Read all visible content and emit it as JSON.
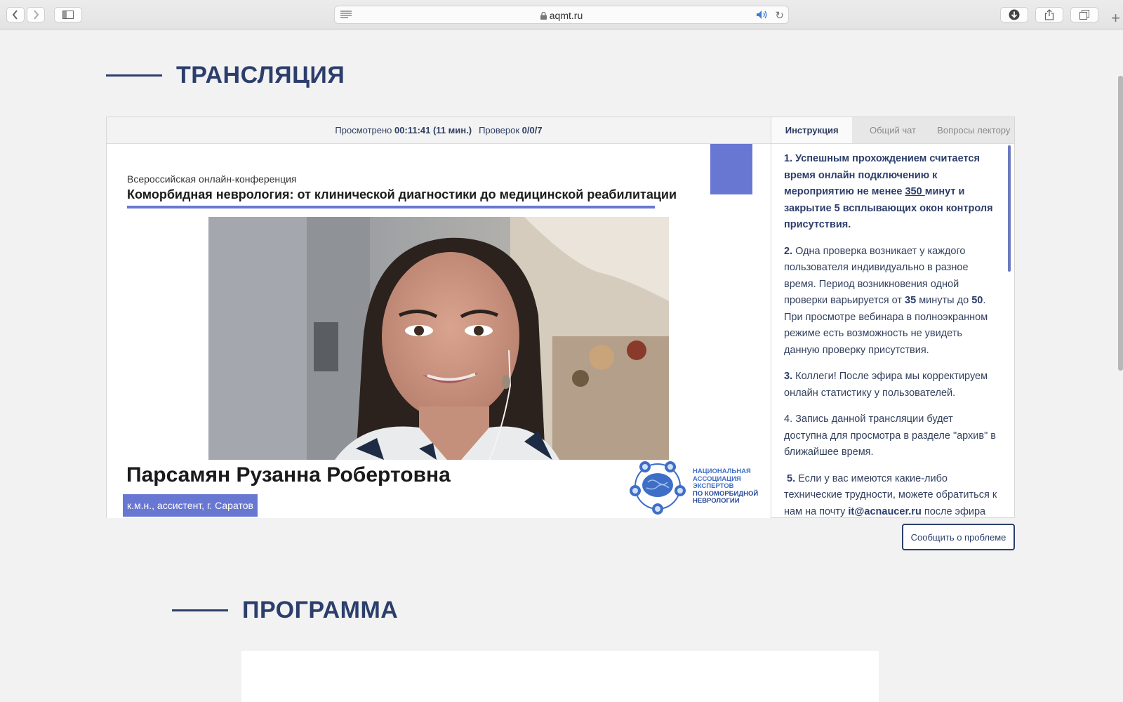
{
  "browser": {
    "url": "aqmt.ru",
    "icons": [
      "back-icon",
      "forward-icon",
      "sidebar-icon",
      "reader-icon",
      "lock-icon",
      "sound-icon",
      "reload-icon",
      "download-icon",
      "share-icon",
      "tabs-icon",
      "new-tab-icon"
    ]
  },
  "sections": {
    "broadcast_title": "ТРАНСЛЯЦИЯ",
    "program_title": "ПРОГРАММА"
  },
  "player": {
    "viewed_label": "Просмотрено",
    "viewed_value": "00:11:41 (11 мин.)",
    "checks_label": "Проверок",
    "checks_value": "0/0/7"
  },
  "slide": {
    "conference_type": "Всероссийская онлайн-конференция",
    "conference_title": "Коморбидная неврология: от клинической диагностики до медицинской реабилитации",
    "speaker_name": "Парсамян Рузанна Робертовна",
    "speaker_role": "к.м.н., ассистент, г. Саратов",
    "logo_lines": [
      "НАЦИОНАЛЬНАЯ",
      "АССОЦИАЦИЯ",
      "ЭКСПЕРТОВ",
      "ПО КОМОРБИДНОЙ",
      "НЕВРОЛОГИИ"
    ]
  },
  "tabs": [
    {
      "label": "Инструкция",
      "active": true
    },
    {
      "label": "Общий чат",
      "active": false
    },
    {
      "label": "Вопросы лектору",
      "active": false
    }
  ],
  "instructions": {
    "p1_a": "1. Успешным прохождением считается время онлайн подключению к мероприятию не менее ",
    "p1_num": "350 ",
    "p1_b": "минут и закрытие 5 всплывающих окон контроля присутствия.",
    "p2_num": "2.",
    "p2_a": " Одна проверка возникает у каждого пользователя индивидуально в разное время. Период возникновения одной проверки варьируется от ",
    "p2_from": "35",
    "p2_b": " минуты до ",
    "p2_to": "50",
    "p2_c": ". При просмотре вебинара в полноэкранном режиме есть возможность не увидеть данную проверку присутствия.",
    "p3_num": "3.",
    "p3_a": " Коллеги! После эфира мы корректируем онлайн статистику у пользователей.",
    "p4": "4. Запись данной трансляции будет доступна для просмотра в разделе \"архив\" в ближайшее время.",
    "p5_num": "5.",
    "p5_a": " Если у вас имеются какие-либо технические трудности, можете обратиться к нам на почту ",
    "p5_email": "it@acnaucer.ru",
    "p5_b": " после эфира"
  },
  "report_button": "Сообщить о проблеме",
  "colors": {
    "accent_blue": "#6877d2",
    "navy": "#2c3e6b",
    "logo_blue": "#3f6ec7"
  }
}
